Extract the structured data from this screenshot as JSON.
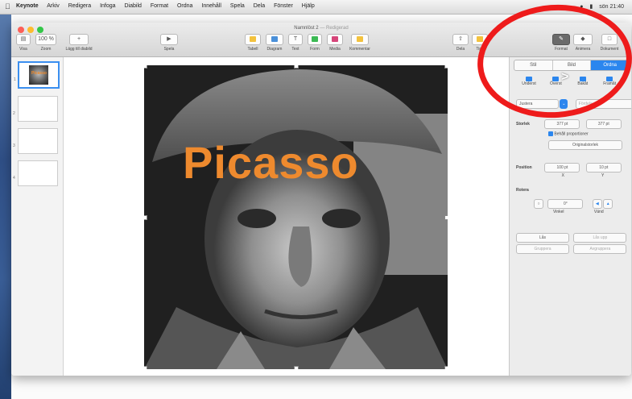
{
  "menubar": {
    "app": "Keynote",
    "items": [
      "Arkiv",
      "Redigera",
      "Infoga",
      "Diabild",
      "Format",
      "Ordna",
      "Innehåll",
      "Spela",
      "Dela",
      "Fönster",
      "Hjälp"
    ],
    "clock": "sön 21:40"
  },
  "window": {
    "title": "Namnlöst 2",
    "subtitle": "— Redigerad"
  },
  "toolbar": {
    "visa": "Visa",
    "zoom": "100 %",
    "lagg_till": "Lägg till diabild",
    "spela": "Spela",
    "tabell": "Tabell",
    "diagram": "Diagram",
    "text": "Text",
    "form": "Form",
    "media": "Media",
    "kommentar": "Kommentar",
    "dela": "Dela",
    "tips": "Tips",
    "format": "Format",
    "animera": "Animera",
    "dokument": "Dokument"
  },
  "navigator": {
    "slides": [
      "1",
      "2",
      "3",
      "4"
    ]
  },
  "slide": {
    "title": "Picasso"
  },
  "inspector": {
    "tabs": [
      "Stil",
      "Bild",
      "Ordna"
    ],
    "active_tab": "Ordna",
    "arrange_buttons": [
      "Underst",
      "Överst",
      "Bakåt",
      "Framåt"
    ],
    "align_value": "Justera",
    "distribute_value": "Fördela",
    "size_label": "Storlek",
    "width_value": "377 pt",
    "height_value": "377 pt",
    "constrain_label": "Behåll proportioner",
    "original_size": "Originalstorlek",
    "position_label": "Position",
    "x_value": "100 pt",
    "y_value": "10 pt",
    "x_label": "X",
    "y_label": "Y",
    "rotate_label": "Rotera",
    "angle_value": "0°",
    "angle_label": "Vinkel",
    "flip_label": "Vänd",
    "lock_label": "Lås",
    "unlock_label": "Lås upp",
    "group_label": "Gruppera",
    "ungroup_label": "Avgruppera"
  },
  "colors": {
    "title_orange": "#ee8a2e",
    "accent_blue": "#2b86ee",
    "annotation_red": "#ee1b1b"
  }
}
